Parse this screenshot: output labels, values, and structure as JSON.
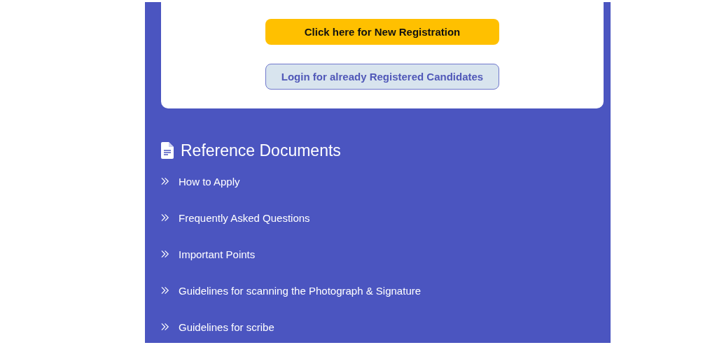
{
  "registration": {
    "new_button": "Click here for New Registration",
    "login_button": "Login for already Registered Candidates"
  },
  "reference": {
    "title": "Reference Documents",
    "links": [
      "How to Apply",
      "Frequently Asked Questions",
      "Important Points",
      "Guidelines for scanning the Photograph & Signature",
      "Guidelines for scribe"
    ]
  }
}
